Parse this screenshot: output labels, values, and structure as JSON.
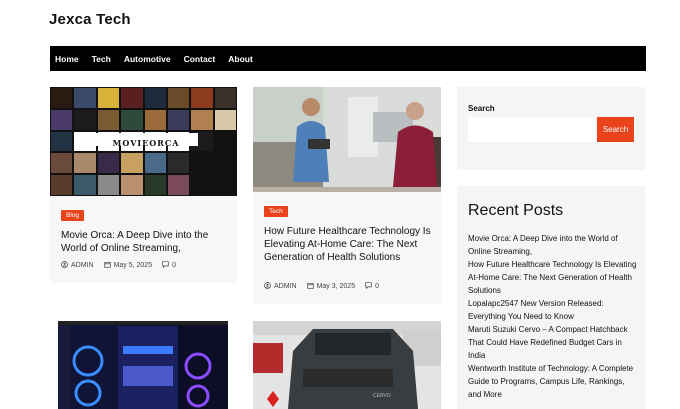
{
  "site": {
    "title": "Jexca Tech"
  },
  "nav": {
    "items": [
      "Home",
      "Tech",
      "Automotive",
      "Contact",
      "About"
    ]
  },
  "posts": [
    {
      "category": "Blog",
      "title": "Movie Orca: A Deep Dive into the World of Online Streaming,",
      "author": "ADMIN",
      "date": "May 5, 2025",
      "comments": "0",
      "image_label": "MOVIEORCA"
    },
    {
      "category": "Tech",
      "title": "How Future Healthcare Technology Is Elevating At-Home Care: The Next Generation of Health Solutions",
      "author": "ADMIN",
      "date": "May 3, 2025",
      "comments": "0"
    }
  ],
  "sidebar": {
    "search": {
      "label": "Search",
      "placeholder": "",
      "button": "Search"
    },
    "recent": {
      "title": "Recent Posts",
      "items": [
        "Movie Orca: A Deep Dive into the World of Online Streaming,",
        "How Future Healthcare Technology Is Elevating At-Home Care: The Next Generation of Health Solutions",
        "Lopalapc2547 New Version Released: Everything You Need to Know",
        "Maruti Suzuki Cervo – A Compact Hatchback That Could Have Redefined Budget Cars in India",
        "Wentworth Institute of Technology: A Complete Guide to Programs, Campus Life, Rankings, and More"
      ]
    }
  },
  "colors": {
    "accent": "#e8431b",
    "nav_bg": "#000000",
    "card_bg": "#f7f7f7"
  },
  "icons": {
    "author": "user-icon",
    "date": "calendar-icon",
    "comments": "comment-icon"
  }
}
